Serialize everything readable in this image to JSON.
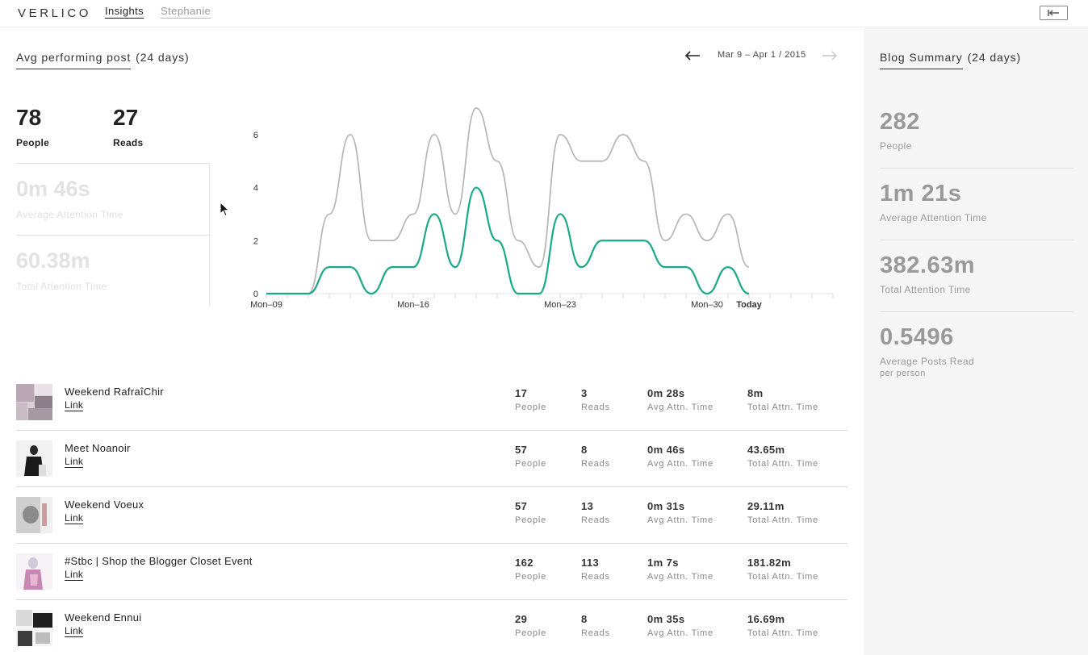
{
  "app": {
    "logo": "VERLICO",
    "nav_insights": "Insights",
    "nav_user": "Stephanie"
  },
  "main": {
    "title": "Avg performing post",
    "period": "(24 days)",
    "date_range": "Mar 9 – Apr 1 / 2015",
    "people_value": "78",
    "people_label": "People",
    "reads_value": "27",
    "reads_label": "Reads",
    "avg_attention_value": "0m 46s",
    "avg_attention_label": "Average Attention Time",
    "total_attention_value": "60.38m",
    "total_attention_label": "Total Attention Time"
  },
  "chart_data": {
    "type": "line",
    "x": [
      "Mar 9",
      "Mar 10",
      "Mar 11",
      "Mar 12",
      "Mar 13",
      "Mar 14",
      "Mar 15",
      "Mar 16",
      "Mar 17",
      "Mar 18",
      "Mar 19",
      "Mar 20",
      "Mar 21",
      "Mar 22",
      "Mar 23",
      "Mar 24",
      "Mar 25",
      "Mar 26",
      "Mar 27",
      "Mar 28",
      "Mar 29",
      "Mar 30",
      "Mar 31",
      "Apr 1"
    ],
    "tick_labels": [
      {
        "index": 0,
        "label": "Mon–09"
      },
      {
        "index": 7,
        "label": "Mon–16"
      },
      {
        "index": 14,
        "label": "Mon–23"
      },
      {
        "index": 21,
        "label": "Mon–30"
      },
      {
        "index": 23,
        "label": "Today"
      }
    ],
    "total_ticks": 28,
    "ylim": [
      0,
      7
    ],
    "yticks": [
      0,
      2,
      4,
      6
    ],
    "grid": false,
    "series": [
      {
        "color": "#b5b5b5",
        "values": [
          0,
          0,
          0,
          3,
          6,
          2,
          2,
          3,
          6,
          3,
          7,
          5,
          2,
          1,
          6,
          5,
          5,
          6,
          5,
          2,
          3,
          2,
          3,
          1
        ]
      },
      {
        "color": "#1aa88a",
        "values": [
          0,
          0,
          0,
          1,
          1,
          0,
          1,
          1,
          3,
          1,
          4,
          2,
          0,
          0,
          3,
          1,
          2,
          2,
          2,
          1,
          1,
          0,
          1,
          0
        ]
      }
    ]
  },
  "posts": [
    {
      "title": "Weekend RafraîChir",
      "link": "Link",
      "people": "17",
      "reads": "3",
      "avg": "0m 28s",
      "total": "8m"
    },
    {
      "title": "Meet Noanoir",
      "link": "Link",
      "people": "57",
      "reads": "8",
      "avg": "0m 46s",
      "total": "43.65m"
    },
    {
      "title": "Weekend Voeux",
      "link": "Link",
      "people": "57",
      "reads": "13",
      "avg": "0m 31s",
      "total": "29.11m"
    },
    {
      "title": "#Stbc | Shop the Blogger Closet Event",
      "link": "Link",
      "people": "162",
      "reads": "113",
      "avg": "1m 7s",
      "total": "181.82m"
    },
    {
      "title": "Weekend Ennui",
      "link": "Link",
      "people": "29",
      "reads": "8",
      "avg": "0m 35s",
      "total": "16.69m"
    }
  ],
  "columns": {
    "people": "People",
    "reads": "Reads",
    "avg": "Avg Attn. Time",
    "total": "Total Attn. Time"
  },
  "sidebar": {
    "title": "Blog Summary",
    "period": "(24 days)",
    "people_value": "282",
    "people_label": "People",
    "avg_attention_value": "1m 21s",
    "avg_attention_label": "Average Attention Time",
    "total_attention_value": "382.63m",
    "total_attention_label": "Total Attention Time",
    "posts_read_value": "0.5496",
    "posts_read_label": "Average Posts Read",
    "posts_read_sub": "per person"
  },
  "icons": {
    "collapse": "collapse-sidebar-icon",
    "prev": "arrow-left-icon",
    "next": "arrow-right-icon"
  }
}
